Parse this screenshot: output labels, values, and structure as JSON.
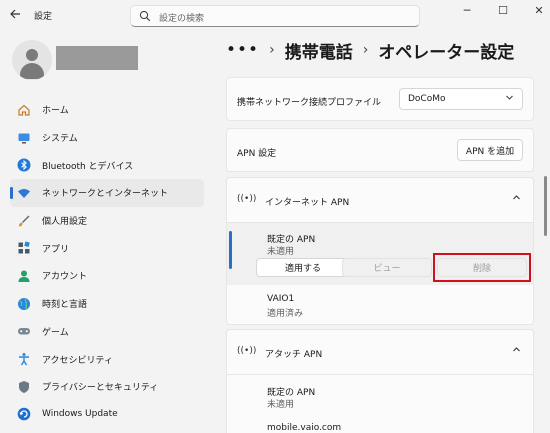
{
  "window": {
    "title": "設定",
    "search_placeholder": "設定の検索",
    "minimize": "─",
    "maximize": "☐",
    "close": "✕"
  },
  "sidebar": {
    "items": [
      {
        "label": "ホーム",
        "icon": "home-icon"
      },
      {
        "label": "システム",
        "icon": "system-icon"
      },
      {
        "label": "Bluetooth とデバイス",
        "icon": "bluetooth-icon"
      },
      {
        "label": "ネットワークとインターネット",
        "icon": "network-icon",
        "active": true
      },
      {
        "label": "個人用設定",
        "icon": "personalization-icon"
      },
      {
        "label": "アプリ",
        "icon": "apps-icon"
      },
      {
        "label": "アカウント",
        "icon": "account-icon"
      },
      {
        "label": "時刻と言語",
        "icon": "time-language-icon"
      },
      {
        "label": "ゲーム",
        "icon": "gaming-icon"
      },
      {
        "label": "アクセシビリティ",
        "icon": "accessibility-icon"
      },
      {
        "label": "プライバシーとセキュリティ",
        "icon": "privacy-icon"
      },
      {
        "label": "Windows Update",
        "icon": "windows-update-icon"
      }
    ]
  },
  "breadcrumb": {
    "dots": "•••",
    "sep": "›",
    "level1": "携帯電話",
    "level2": "オペレーター設定"
  },
  "profile_card": {
    "label": "携帯ネットワーク接続プロファイル",
    "value": "DoCoMo"
  },
  "apn_settings_card": {
    "label": "APN 設定",
    "add_button": "APN を追加"
  },
  "internet_apn": {
    "title": "インターネット APN",
    "items": [
      {
        "name": "既定の APN",
        "status": "未適用"
      },
      {
        "name": "VAIO1",
        "status": "適用済み"
      }
    ],
    "apply_button": "適用する",
    "view_button": "ビュー",
    "delete_button": "削除"
  },
  "attach_apn": {
    "title": "アタッチ APN",
    "items": [
      {
        "name": "既定の APN",
        "status": "未適用"
      },
      {
        "name": "mobile.vaio.com",
        "status": ""
      }
    ]
  },
  "colors": {
    "accent": "#2b6ec7",
    "highlight": "#d0101c",
    "background": "#f3f3f3"
  }
}
